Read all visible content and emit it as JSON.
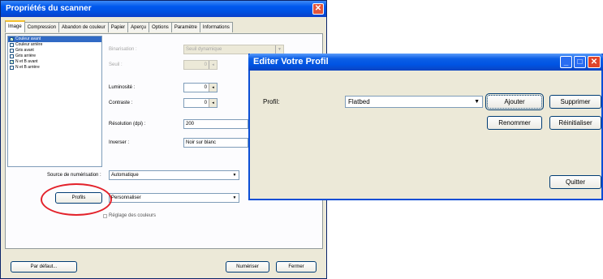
{
  "scanner": {
    "title": "Propriétés du scanner",
    "close_glyph": "✕",
    "tabs": [
      "Image",
      "Compression",
      "Abandon de couleur",
      "Papier",
      "Aperçu",
      "Options",
      "Paramètre",
      "Informations"
    ],
    "image_list": [
      {
        "label": "Couleur avant",
        "checked": true,
        "selected": true
      },
      {
        "label": "Couleur arrière",
        "checked": false,
        "selected": false
      },
      {
        "label": "Gris avant",
        "checked": false,
        "selected": false
      },
      {
        "label": "Gris arrière",
        "checked": false,
        "selected": false
      },
      {
        "label": "N et B avant",
        "checked": true,
        "selected": false
      },
      {
        "label": "N et B arrière",
        "checked": false,
        "selected": false
      }
    ],
    "settings": {
      "binarisation_label": "Binarisation :",
      "binarisation_value": "Seuil dynamique",
      "seuil_label": "Seuil :",
      "seuil_value": "0",
      "luminosite_label": "Luminosité :",
      "luminosite_value": "0",
      "contraste_label": "Contraste :",
      "contraste_value": "0",
      "resolution_label": "Résolution (dpi) :",
      "resolution_value": "200",
      "inverser_label": "Inverser :",
      "inverser_value": "Noir sur blanc"
    },
    "source_label": "Source de numérisation :",
    "source_value": "Automatique",
    "profils_button": "Profils",
    "profile_value": "Personnaliser",
    "color_adjust_label": "Réglage des couleurs",
    "default_button": "Par défaut...",
    "scan_button": "Numériser",
    "close_button": "Fermer"
  },
  "edit_profile": {
    "title": "Editer Votre Profil",
    "profile_label": "Profil:",
    "profile_value": "Flatbed",
    "add_button": "Ajouter",
    "delete_button": "Supprimer",
    "rename_button": "Renommer",
    "reset_button": "Réinitialiser",
    "quit_button": "Quitter"
  },
  "annotation_color": "#e3222b"
}
